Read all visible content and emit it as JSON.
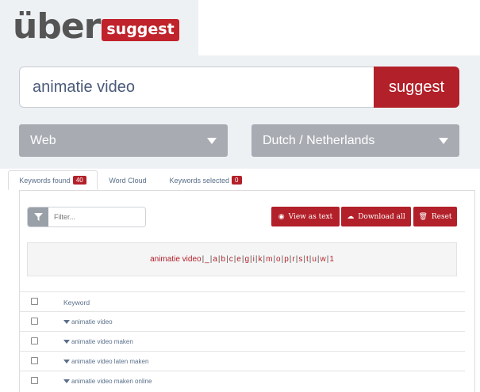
{
  "logo": {
    "part1": "über",
    "part2": "suggest"
  },
  "search": {
    "value": "animatie video",
    "button_label": "suggest"
  },
  "selects": {
    "source": "Web",
    "locale": "Dutch / Netherlands"
  },
  "tabs": [
    {
      "label": "Keywords found",
      "badge": "40"
    },
    {
      "label": "Word Cloud"
    },
    {
      "label": "Keywords selected",
      "badge": "0"
    }
  ],
  "filter": {
    "placeholder": "Filter..."
  },
  "actions": {
    "view_text": "View as text",
    "download": "Download all",
    "reset": "Reset"
  },
  "alphabet": {
    "main": "animatie video",
    "letters": [
      "_",
      "a",
      "b",
      "c",
      "e",
      "g",
      "i",
      "k",
      "m",
      "o",
      "p",
      "r",
      "s",
      "t",
      "u",
      "w",
      "1"
    ]
  },
  "table": {
    "header": "Keyword",
    "rows": [
      "animatie video",
      "animatie video maken",
      "animatie video laten maken",
      "animatie video maken online"
    ]
  },
  "colors": {
    "brand_red": "#b22029",
    "select_gray": "#a8acb2",
    "band": "#eef1f4"
  },
  "icons": {
    "filter": "filter-icon",
    "view": "eye-icon",
    "download": "cloud-download-icon",
    "reset": "trash-icon",
    "caret": "caret-down-icon"
  }
}
